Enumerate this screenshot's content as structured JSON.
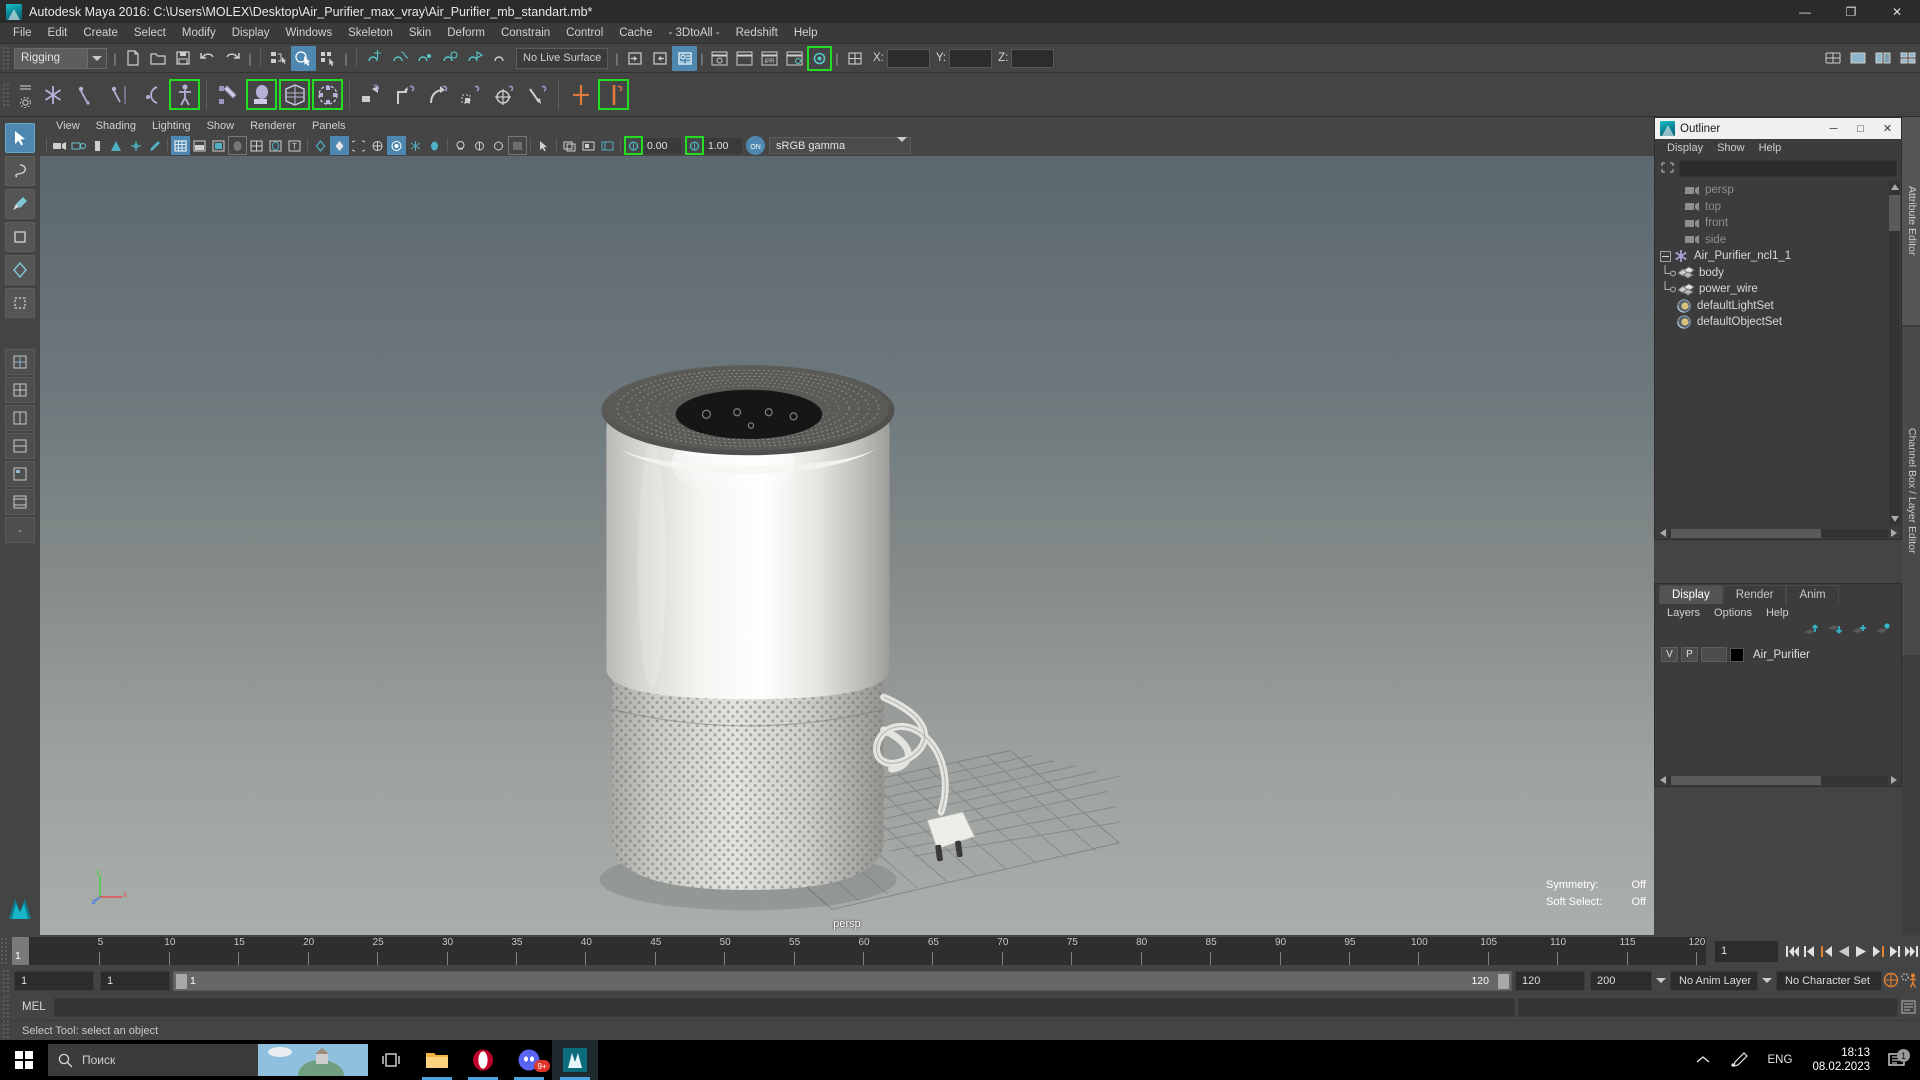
{
  "window": {
    "title": "Autodesk Maya 2016: C:\\Users\\MOLEX\\Desktop\\Air_Purifier_max_vray\\Air_Purifier_mb_standart.mb*",
    "minimize": "—",
    "maximize": "❐",
    "close": "✕"
  },
  "menubar": {
    "items": [
      "File",
      "Edit",
      "Create",
      "Select",
      "Modify",
      "Display",
      "Windows",
      "Skeleton",
      "Skin",
      "Deform",
      "Constrain",
      "Control",
      "Cache",
      "- 3DtoAll -",
      "Redshift",
      "Help"
    ]
  },
  "statusline": {
    "menu_set": "Rigging",
    "live_surface": "No Live Surface",
    "coords": {
      "x_label": "X:",
      "y_label": "Y:",
      "z_label": "Z:",
      "x": "",
      "y": "",
      "z": ""
    }
  },
  "viewport_menu": {
    "items": [
      "View",
      "Shading",
      "Lighting",
      "Show",
      "Renderer",
      "Panels"
    ]
  },
  "viewport_toolbar": {
    "exposure": "0.00",
    "gamma": "1.00",
    "color_profile": "sRGB gamma"
  },
  "viewport": {
    "camera_label": "persp",
    "stats": [
      {
        "key": "Symmetry:",
        "value": "Off"
      },
      {
        "key": "Soft Select:",
        "value": "Off"
      }
    ],
    "axis": {
      "x": "x",
      "y": "y",
      "z": "z"
    }
  },
  "outliner": {
    "title": "Outliner",
    "menus": [
      "Display",
      "Show",
      "Help"
    ],
    "search_value": "",
    "nodes": [
      {
        "label": "persp",
        "type": "camera",
        "depth": 1,
        "dim": true,
        "expander": false,
        "elbow": false
      },
      {
        "label": "top",
        "type": "camera",
        "depth": 1,
        "dim": true,
        "expander": false,
        "elbow": false
      },
      {
        "label": "front",
        "type": "camera",
        "depth": 1,
        "dim": true,
        "expander": false,
        "elbow": false
      },
      {
        "label": "side",
        "type": "camera",
        "depth": 1,
        "dim": true,
        "expander": false,
        "elbow": false
      },
      {
        "label": "Air_Purifier_ncl1_1",
        "type": "group",
        "depth": 0,
        "dim": false,
        "expander": true,
        "elbow": false
      },
      {
        "label": "body",
        "type": "mesh",
        "depth": 2,
        "dim": false,
        "expander": false,
        "elbow": true
      },
      {
        "label": "power_wire",
        "type": "mesh",
        "depth": 2,
        "dim": false,
        "expander": false,
        "elbow": true
      },
      {
        "label": "defaultLightSet",
        "type": "set",
        "depth": 1,
        "dim": false,
        "expander": false,
        "elbow": false
      },
      {
        "label": "defaultObjectSet",
        "type": "set",
        "depth": 1,
        "dim": false,
        "expander": false,
        "elbow": false
      }
    ]
  },
  "layer_editor": {
    "tabs": [
      {
        "label": "Display",
        "active": true
      },
      {
        "label": "Render",
        "active": false
      },
      {
        "label": "Anim",
        "active": false
      }
    ],
    "menus": [
      "Layers",
      "Options",
      "Help"
    ],
    "layers": [
      {
        "visibility": "V",
        "playback": "P",
        "type": "",
        "color": "#000000",
        "name": "Air_Purifier"
      }
    ]
  },
  "right_vtabs": [
    {
      "label": "Attribute Editor"
    },
    {
      "label": "Channel Box / Layer Editor"
    }
  ],
  "timeline": {
    "current_frame": "1",
    "current_field": "1",
    "ticks": [
      5,
      10,
      15,
      20,
      25,
      30,
      35,
      40,
      45,
      50,
      55,
      60,
      65,
      70,
      75,
      80,
      85,
      90,
      95,
      100,
      105,
      110,
      115,
      120
    ],
    "max": 120
  },
  "range": {
    "start": "1",
    "anim_start": "1",
    "range_start_label": "1",
    "range_end_label": "120",
    "anim_end": "120",
    "end": "200",
    "anim_layer": "No Anim Layer",
    "character_set": "No Character Set"
  },
  "command_line": {
    "language": "MEL",
    "input_value": "",
    "output_value": ""
  },
  "help_line": {
    "text": "Select Tool: select an object"
  },
  "taskbar": {
    "search_placeholder": "Поиск",
    "language": "ENG",
    "time": "18:13",
    "date": "08.02.2023",
    "notification_count": "1"
  }
}
